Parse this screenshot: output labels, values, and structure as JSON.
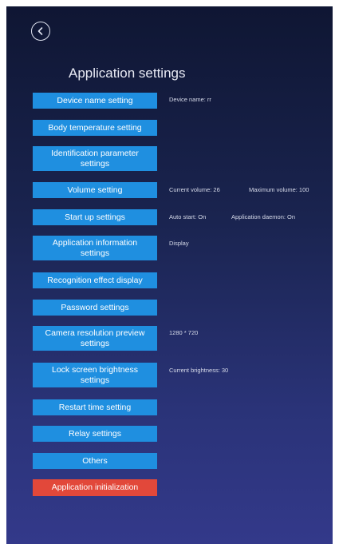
{
  "header": {
    "back_icon": "back-arrow-icon",
    "title": "Application settings"
  },
  "buttons": {
    "device_name": "Device name setting",
    "body_temp": "Body temperature setting",
    "identification": "Identification parameter settings",
    "volume": "Volume setting",
    "startup": "Start up settings",
    "app_info": "Application information settings",
    "recognition": "Recognition effect display",
    "password": "Password settings",
    "camera": "Camera resolution preview settings",
    "lock_brightness": "Lock screen brightness settings",
    "restart": "Restart time setting",
    "relay": "Relay settings",
    "others": "Others",
    "init": "Application initialization"
  },
  "info": {
    "device_name": "Device name: rr",
    "current_volume": "Current volume: 26",
    "maximum_volume": "Maximum volume: 100",
    "auto_start": "Auto start: On",
    "app_daemon": "Application   daemon: On",
    "display": "Display",
    "resolution": "1280 * 720",
    "brightness": "Current brightness:  30"
  },
  "colors": {
    "button": "#1f8fe0",
    "danger": "#e2483a",
    "bg_top": "#0f1633",
    "bg_bottom": "#33398a"
  }
}
